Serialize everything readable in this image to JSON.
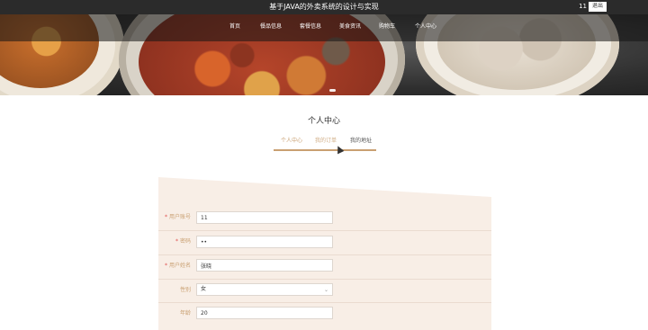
{
  "header": {
    "site_title": "基于JAVA的外卖系统的设计与实现",
    "user_name": "11",
    "logout_label": "退出"
  },
  "nav": {
    "items": [
      {
        "label": "首页"
      },
      {
        "label": "餐品信息"
      },
      {
        "label": "套餐信息"
      },
      {
        "label": "美食资讯"
      },
      {
        "label": "购物车"
      },
      {
        "label": "个人中心"
      }
    ]
  },
  "section": {
    "title": "个人中心"
  },
  "tabs": [
    {
      "label": "个人中心"
    },
    {
      "label": "我的订单"
    },
    {
      "label": "我的地址"
    }
  ],
  "form": {
    "fields": [
      {
        "label": "用户账号",
        "required": true,
        "value": "11"
      },
      {
        "label": "密码",
        "required": true,
        "value": "••"
      },
      {
        "label": "用户姓名",
        "required": true,
        "value": "张晓"
      },
      {
        "label": "性别",
        "required": false,
        "value": "女"
      },
      {
        "label": "年龄",
        "required": false,
        "value": "20"
      }
    ]
  },
  "colors": {
    "accent": "#c9a072",
    "topbar": "#2b2b2b",
    "panel": "#f8eee6",
    "required": "#e05050"
  }
}
